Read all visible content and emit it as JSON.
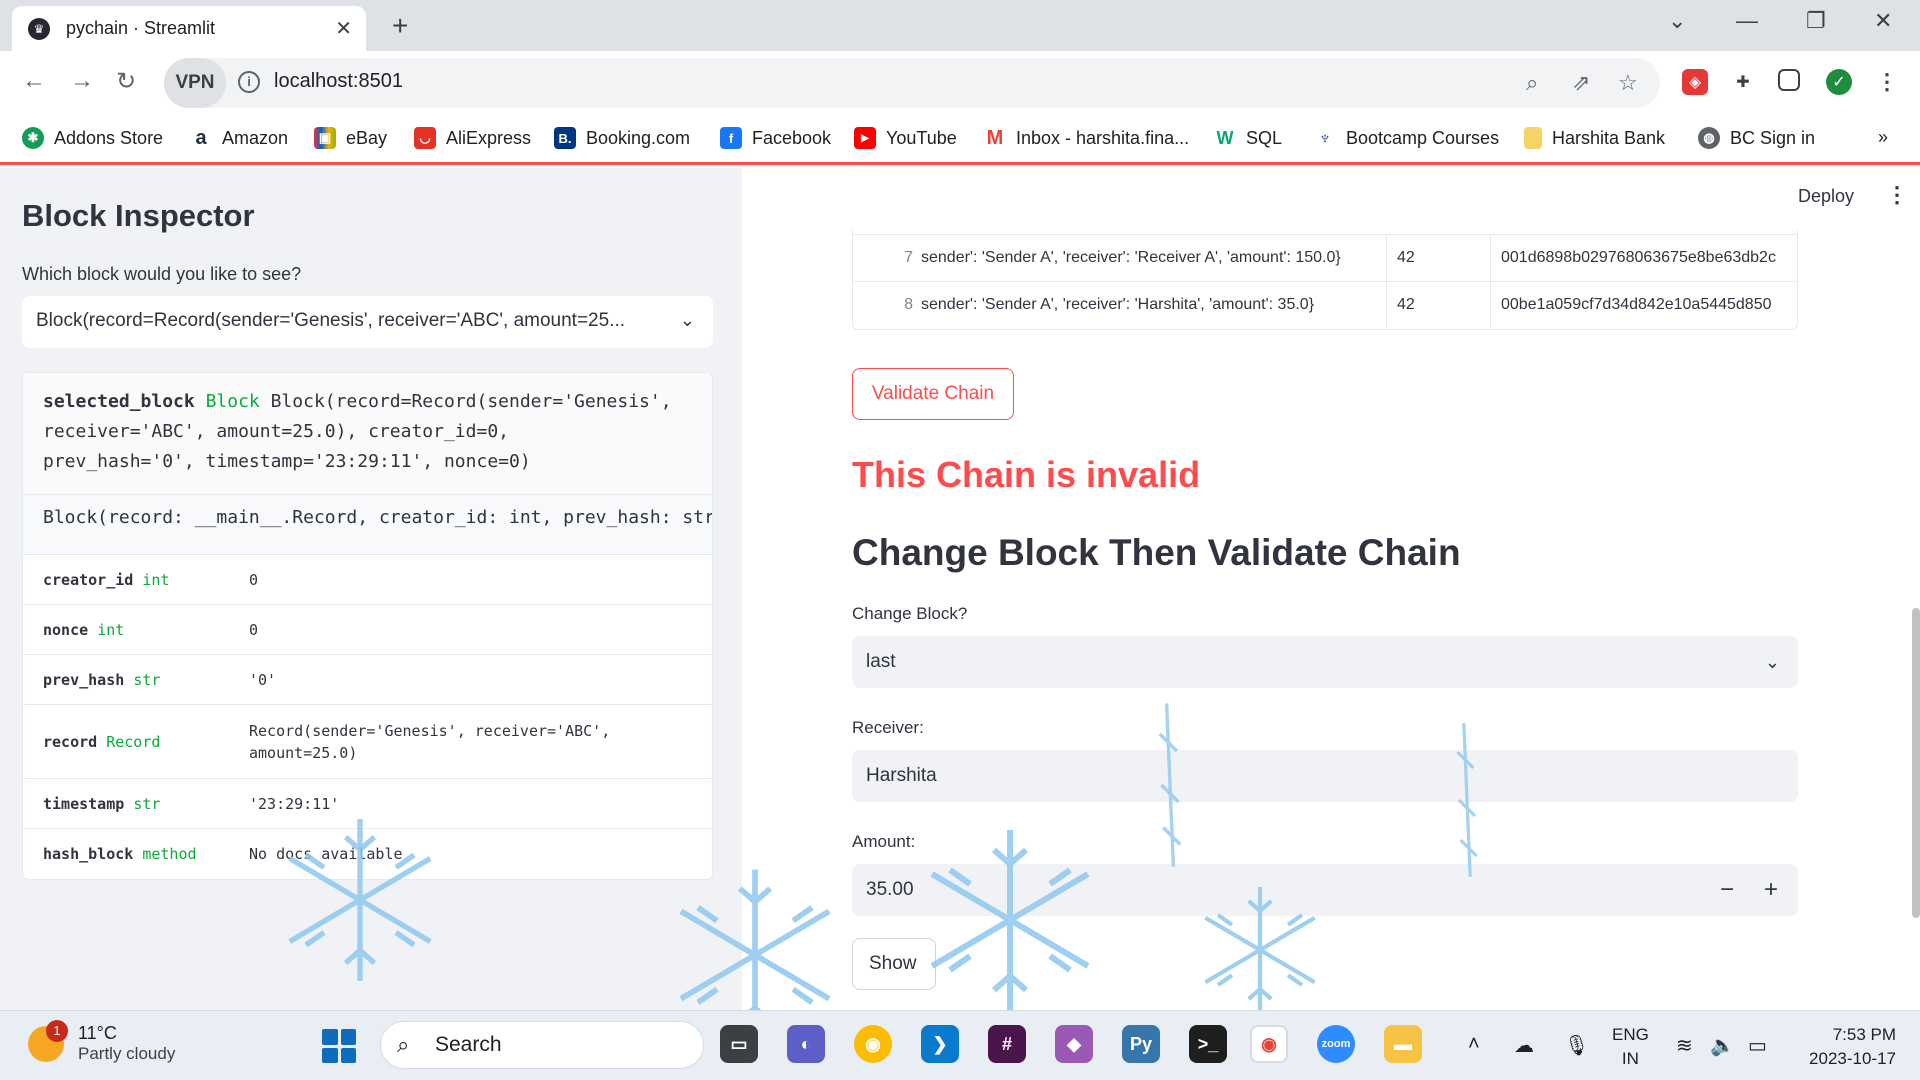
{
  "browser": {
    "tab_title": "pychain · Streamlit",
    "url": "localhost:8501",
    "vpn_label": "VPN",
    "bookmarks": [
      {
        "label": "Addons Store",
        "icon": "addons-icon",
        "color": "#0f9d58"
      },
      {
        "label": "Amazon",
        "icon": "amazon-icon",
        "color": "#232f3e"
      },
      {
        "label": "eBay",
        "icon": "ebay-icon",
        "color": "#e53238"
      },
      {
        "label": "AliExpress",
        "icon": "aliexpress-icon",
        "color": "#e43225"
      },
      {
        "label": "Booking.com",
        "icon": "booking-icon",
        "color": "#003580"
      },
      {
        "label": "Facebook",
        "icon": "facebook-icon",
        "color": "#1877f2"
      },
      {
        "label": "YouTube",
        "icon": "youtube-icon",
        "color": "#ff0000"
      },
      {
        "label": "Inbox - harshita.fina...",
        "icon": "gmail-icon",
        "color": "#ea4335"
      },
      {
        "label": "SQL",
        "icon": "w3schools-icon",
        "color": "#04aa6d"
      },
      {
        "label": "Bootcamp Courses",
        "icon": "bootcamp-icon",
        "color": "#1a4f8b"
      },
      {
        "label": "Harshita Bank",
        "icon": "folder-icon",
        "color": "#f6d365"
      },
      {
        "label": "BC Sign in",
        "icon": "globe-icon",
        "color": "#5f6368"
      }
    ],
    "more_label": "»"
  },
  "sidebar": {
    "title": "Block Inspector",
    "select_label": "Which block would you like to see?",
    "select_value": "Block(record=Record(sender='Genesis', receiver='ABC', amount=25...",
    "inspector": {
      "var_name": "selected_block",
      "type_name": "Block",
      "repr_line1": "Block(record=Record(sender='Genesis',",
      "repr_line2": "receiver='ABC', amount=25.0), creator_id=0,",
      "repr_line3": "prev_hash='0', timestamp='23:29:11', nonce=0)",
      "signature": "Block(record: __main__.Record, creator_id: int, prev_hash: str",
      "rows": [
        {
          "key": "creator_id",
          "type": "int",
          "value": "0"
        },
        {
          "key": "nonce",
          "type": "int",
          "value": "0"
        },
        {
          "key": "prev_hash",
          "type": "str",
          "value": "'0'"
        },
        {
          "key": "record",
          "type": "Record",
          "value": "Record(sender='Genesis', receiver='ABC', amount=25.0)"
        },
        {
          "key": "timestamp",
          "type": "str",
          "value": "'23:29:11'"
        },
        {
          "key": "hash_block",
          "type": "method",
          "value": "No docs available"
        }
      ]
    }
  },
  "main": {
    "deploy_label": "Deploy",
    "table_rows": [
      {
        "index": "7",
        "record": "sender': 'Sender A', 'receiver': 'Receiver A', 'amount': 150.0}",
        "creator_id": "42",
        "hash": "001d6898b029768063675e8be63db2c"
      },
      {
        "index": "8",
        "record": "sender': 'Sender A', 'receiver': 'Harshita', 'amount': 35.0}",
        "creator_id": "42",
        "hash": "00be1a059cf7d34d842e10a5445d850"
      }
    ],
    "validate_button": "Validate Chain",
    "invalid_message": "This Chain is invalid",
    "change_heading": "Change Block Then Validate Chain",
    "change_block_label": "Change Block?",
    "change_block_value": "last",
    "receiver_label": "Receiver:",
    "receiver_value": "Harshita",
    "amount_label": "Amount:",
    "amount_value": "35.00",
    "minus": "−",
    "plus": "+",
    "show_button": "Show"
  },
  "taskbar": {
    "temperature": "11°C",
    "weather": "Partly cloudy",
    "notification_count": "1",
    "search_placeholder": "Search",
    "lang_line1": "ENG",
    "lang_line2": "IN",
    "time": "7:53 PM",
    "date": "2023-10-17"
  },
  "colors": {
    "accent_red": "#ff4b4b",
    "sidebar_bg": "#f0f2f6",
    "type_green": "#09ab3b"
  }
}
